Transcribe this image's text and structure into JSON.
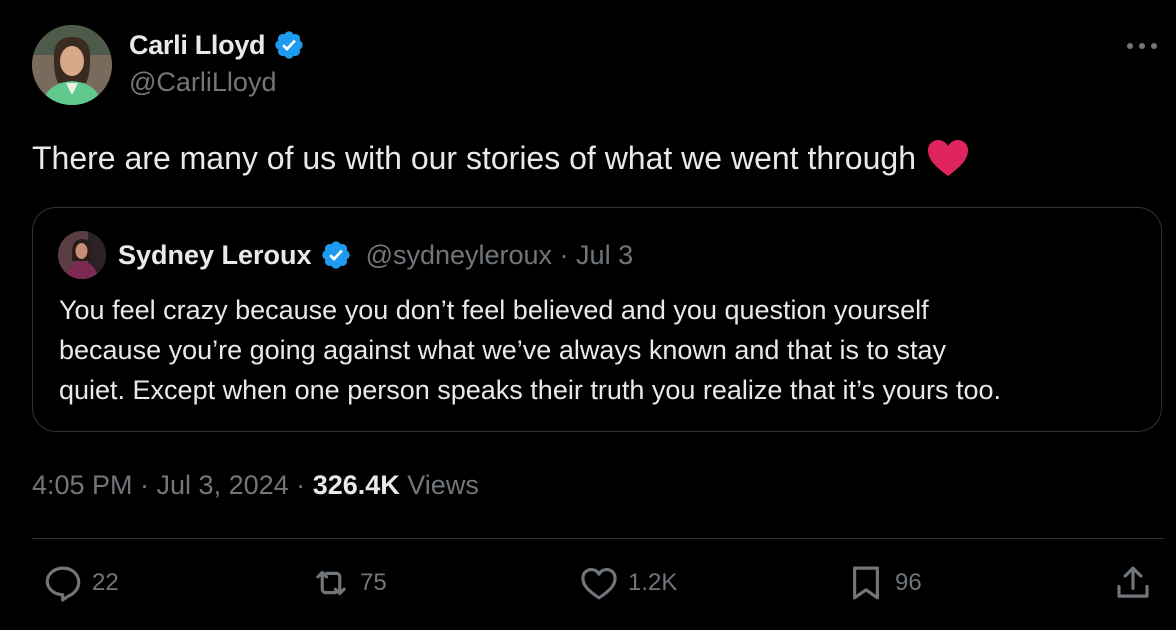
{
  "tweet": {
    "author": {
      "name": "Carli Lloyd",
      "handle": "@CarliLloyd"
    },
    "text": "There are many of us with our stories of what we went through",
    "quoted": {
      "author_name": "Sydney Leroux",
      "meta": "@sydneyleroux · Jul 3",
      "lines": [
        "You feel crazy because you don’t feel believed and you question yourself",
        "because you’re going against what we’ve always known and that is to stay",
        "quiet. Except when one person speaks their truth you realize that it’s yours too."
      ]
    },
    "timestamp": "4:05 PM · Jul 3, 2024",
    "separator": "·",
    "views_count": "326.4K",
    "views_label": "Views",
    "actions": {
      "replies": "22",
      "reposts": "75",
      "likes": "1.2K",
      "bookmarks": "96"
    }
  },
  "colors": {
    "background": "#000000",
    "text": "#e7e9ea",
    "secondary": "#71767b",
    "verified": "#1d9bf0",
    "heart": "#e0245e",
    "border": "#2f3336"
  },
  "icons": [
    "more-icon",
    "verified-badge-icon",
    "heart-emoji-icon",
    "reply-icon",
    "repost-icon",
    "like-icon",
    "bookmark-icon",
    "share-icon"
  ]
}
